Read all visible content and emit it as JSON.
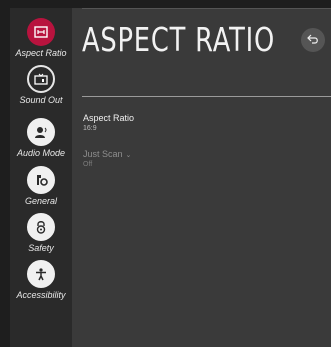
{
  "sidebar": {
    "items": [
      {
        "label": "Aspect Ratio",
        "icon": "aspect-ratio-icon",
        "active": true
      },
      {
        "label": "Sound Out",
        "icon": "sound-out-icon",
        "active": false
      },
      {
        "label": "Audio Mode",
        "icon": "audio-mode-icon",
        "active": false
      },
      {
        "label": "General",
        "icon": "general-icon",
        "active": false
      },
      {
        "label": "Safety",
        "icon": "safety-lock-icon",
        "active": false
      },
      {
        "label": "Accessibility",
        "icon": "accessibility-icon",
        "active": false
      }
    ]
  },
  "header": {
    "title": "ASPECT RATIO",
    "back_icon": "back-icon"
  },
  "options": [
    {
      "label": "Aspect Ratio",
      "value": "16:9",
      "enabled": true
    },
    {
      "label": "Just Scan",
      "value": "Off",
      "enabled": false,
      "has_dropdown": true
    }
  ],
  "colors": {
    "accent": "#b8133e",
    "background": "#3a3a3a",
    "sidebar": "#2a2a2a"
  }
}
